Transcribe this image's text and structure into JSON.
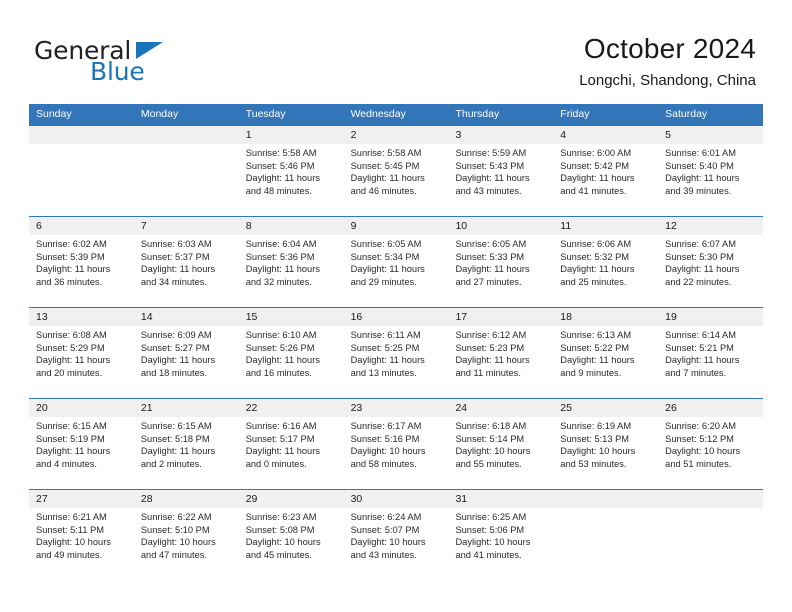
{
  "brand": {
    "word1": "General",
    "word2": "Blue",
    "logo_icon": "triangle-icon"
  },
  "header": {
    "title": "October 2024",
    "subtitle": "Longchi, Shandong, China"
  },
  "colors": {
    "header_blue": "#3275b8",
    "brand_blue": "#1b75bb",
    "daynum_band": "#f0f0f0",
    "text": "#1a1a1a"
  },
  "calendar": {
    "weekday_headers": [
      "Sunday",
      "Monday",
      "Tuesday",
      "Wednesday",
      "Thursday",
      "Friday",
      "Saturday"
    ],
    "weeks": [
      [
        {
          "day": "",
          "sunrise": "",
          "sunset": "",
          "daylight1": "",
          "daylight2": ""
        },
        {
          "day": "",
          "sunrise": "",
          "sunset": "",
          "daylight1": "",
          "daylight2": ""
        },
        {
          "day": "1",
          "sunrise": "Sunrise: 5:58 AM",
          "sunset": "Sunset: 5:46 PM",
          "daylight1": "Daylight: 11 hours",
          "daylight2": "and 48 minutes."
        },
        {
          "day": "2",
          "sunrise": "Sunrise: 5:58 AM",
          "sunset": "Sunset: 5:45 PM",
          "daylight1": "Daylight: 11 hours",
          "daylight2": "and 46 minutes."
        },
        {
          "day": "3",
          "sunrise": "Sunrise: 5:59 AM",
          "sunset": "Sunset: 5:43 PM",
          "daylight1": "Daylight: 11 hours",
          "daylight2": "and 43 minutes."
        },
        {
          "day": "4",
          "sunrise": "Sunrise: 6:00 AM",
          "sunset": "Sunset: 5:42 PM",
          "daylight1": "Daylight: 11 hours",
          "daylight2": "and 41 minutes."
        },
        {
          "day": "5",
          "sunrise": "Sunrise: 6:01 AM",
          "sunset": "Sunset: 5:40 PM",
          "daylight1": "Daylight: 11 hours",
          "daylight2": "and 39 minutes."
        }
      ],
      [
        {
          "day": "6",
          "sunrise": "Sunrise: 6:02 AM",
          "sunset": "Sunset: 5:39 PM",
          "daylight1": "Daylight: 11 hours",
          "daylight2": "and 36 minutes."
        },
        {
          "day": "7",
          "sunrise": "Sunrise: 6:03 AM",
          "sunset": "Sunset: 5:37 PM",
          "daylight1": "Daylight: 11 hours",
          "daylight2": "and 34 minutes."
        },
        {
          "day": "8",
          "sunrise": "Sunrise: 6:04 AM",
          "sunset": "Sunset: 5:36 PM",
          "daylight1": "Daylight: 11 hours",
          "daylight2": "and 32 minutes."
        },
        {
          "day": "9",
          "sunrise": "Sunrise: 6:05 AM",
          "sunset": "Sunset: 5:34 PM",
          "daylight1": "Daylight: 11 hours",
          "daylight2": "and 29 minutes."
        },
        {
          "day": "10",
          "sunrise": "Sunrise: 6:05 AM",
          "sunset": "Sunset: 5:33 PM",
          "daylight1": "Daylight: 11 hours",
          "daylight2": "and 27 minutes."
        },
        {
          "day": "11",
          "sunrise": "Sunrise: 6:06 AM",
          "sunset": "Sunset: 5:32 PM",
          "daylight1": "Daylight: 11 hours",
          "daylight2": "and 25 minutes."
        },
        {
          "day": "12",
          "sunrise": "Sunrise: 6:07 AM",
          "sunset": "Sunset: 5:30 PM",
          "daylight1": "Daylight: 11 hours",
          "daylight2": "and 22 minutes."
        }
      ],
      [
        {
          "day": "13",
          "sunrise": "Sunrise: 6:08 AM",
          "sunset": "Sunset: 5:29 PM",
          "daylight1": "Daylight: 11 hours",
          "daylight2": "and 20 minutes."
        },
        {
          "day": "14",
          "sunrise": "Sunrise: 6:09 AM",
          "sunset": "Sunset: 5:27 PM",
          "daylight1": "Daylight: 11 hours",
          "daylight2": "and 18 minutes."
        },
        {
          "day": "15",
          "sunrise": "Sunrise: 6:10 AM",
          "sunset": "Sunset: 5:26 PM",
          "daylight1": "Daylight: 11 hours",
          "daylight2": "and 16 minutes."
        },
        {
          "day": "16",
          "sunrise": "Sunrise: 6:11 AM",
          "sunset": "Sunset: 5:25 PM",
          "daylight1": "Daylight: 11 hours",
          "daylight2": "and 13 minutes."
        },
        {
          "day": "17",
          "sunrise": "Sunrise: 6:12 AM",
          "sunset": "Sunset: 5:23 PM",
          "daylight1": "Daylight: 11 hours",
          "daylight2": "and 11 minutes."
        },
        {
          "day": "18",
          "sunrise": "Sunrise: 6:13 AM",
          "sunset": "Sunset: 5:22 PM",
          "daylight1": "Daylight: 11 hours",
          "daylight2": "and 9 minutes."
        },
        {
          "day": "19",
          "sunrise": "Sunrise: 6:14 AM",
          "sunset": "Sunset: 5:21 PM",
          "daylight1": "Daylight: 11 hours",
          "daylight2": "and 7 minutes."
        }
      ],
      [
        {
          "day": "20",
          "sunrise": "Sunrise: 6:15 AM",
          "sunset": "Sunset: 5:19 PM",
          "daylight1": "Daylight: 11 hours",
          "daylight2": "and 4 minutes."
        },
        {
          "day": "21",
          "sunrise": "Sunrise: 6:15 AM",
          "sunset": "Sunset: 5:18 PM",
          "daylight1": "Daylight: 11 hours",
          "daylight2": "and 2 minutes."
        },
        {
          "day": "22",
          "sunrise": "Sunrise: 6:16 AM",
          "sunset": "Sunset: 5:17 PM",
          "daylight1": "Daylight: 11 hours",
          "daylight2": "and 0 minutes."
        },
        {
          "day": "23",
          "sunrise": "Sunrise: 6:17 AM",
          "sunset": "Sunset: 5:16 PM",
          "daylight1": "Daylight: 10 hours",
          "daylight2": "and 58 minutes."
        },
        {
          "day": "24",
          "sunrise": "Sunrise: 6:18 AM",
          "sunset": "Sunset: 5:14 PM",
          "daylight1": "Daylight: 10 hours",
          "daylight2": "and 55 minutes."
        },
        {
          "day": "25",
          "sunrise": "Sunrise: 6:19 AM",
          "sunset": "Sunset: 5:13 PM",
          "daylight1": "Daylight: 10 hours",
          "daylight2": "and 53 minutes."
        },
        {
          "day": "26",
          "sunrise": "Sunrise: 6:20 AM",
          "sunset": "Sunset: 5:12 PM",
          "daylight1": "Daylight: 10 hours",
          "daylight2": "and 51 minutes."
        }
      ],
      [
        {
          "day": "27",
          "sunrise": "Sunrise: 6:21 AM",
          "sunset": "Sunset: 5:11 PM",
          "daylight1": "Daylight: 10 hours",
          "daylight2": "and 49 minutes."
        },
        {
          "day": "28",
          "sunrise": "Sunrise: 6:22 AM",
          "sunset": "Sunset: 5:10 PM",
          "daylight1": "Daylight: 10 hours",
          "daylight2": "and 47 minutes."
        },
        {
          "day": "29",
          "sunrise": "Sunrise: 6:23 AM",
          "sunset": "Sunset: 5:08 PM",
          "daylight1": "Daylight: 10 hours",
          "daylight2": "and 45 minutes."
        },
        {
          "day": "30",
          "sunrise": "Sunrise: 6:24 AM",
          "sunset": "Sunset: 5:07 PM",
          "daylight1": "Daylight: 10 hours",
          "daylight2": "and 43 minutes."
        },
        {
          "day": "31",
          "sunrise": "Sunrise: 6:25 AM",
          "sunset": "Sunset: 5:06 PM",
          "daylight1": "Daylight: 10 hours",
          "daylight2": "and 41 minutes."
        },
        {
          "day": "",
          "sunrise": "",
          "sunset": "",
          "daylight1": "",
          "daylight2": ""
        },
        {
          "day": "",
          "sunrise": "",
          "sunset": "",
          "daylight1": "",
          "daylight2": ""
        }
      ]
    ]
  }
}
